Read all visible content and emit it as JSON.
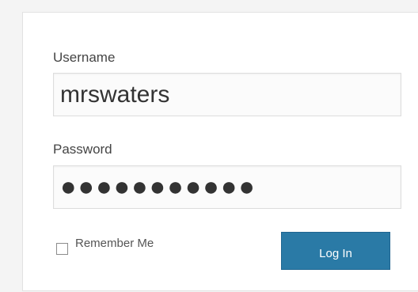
{
  "form": {
    "username_label": "Username",
    "username_value": "mrswaters",
    "password_label": "Password",
    "password_value": "●●●●●●●●●●●",
    "remember_label": "Remember Me",
    "login_button": "Log In"
  },
  "colors": {
    "button": "#2a7aa6",
    "text": "#444444",
    "field_background": "#fbfbfb"
  }
}
